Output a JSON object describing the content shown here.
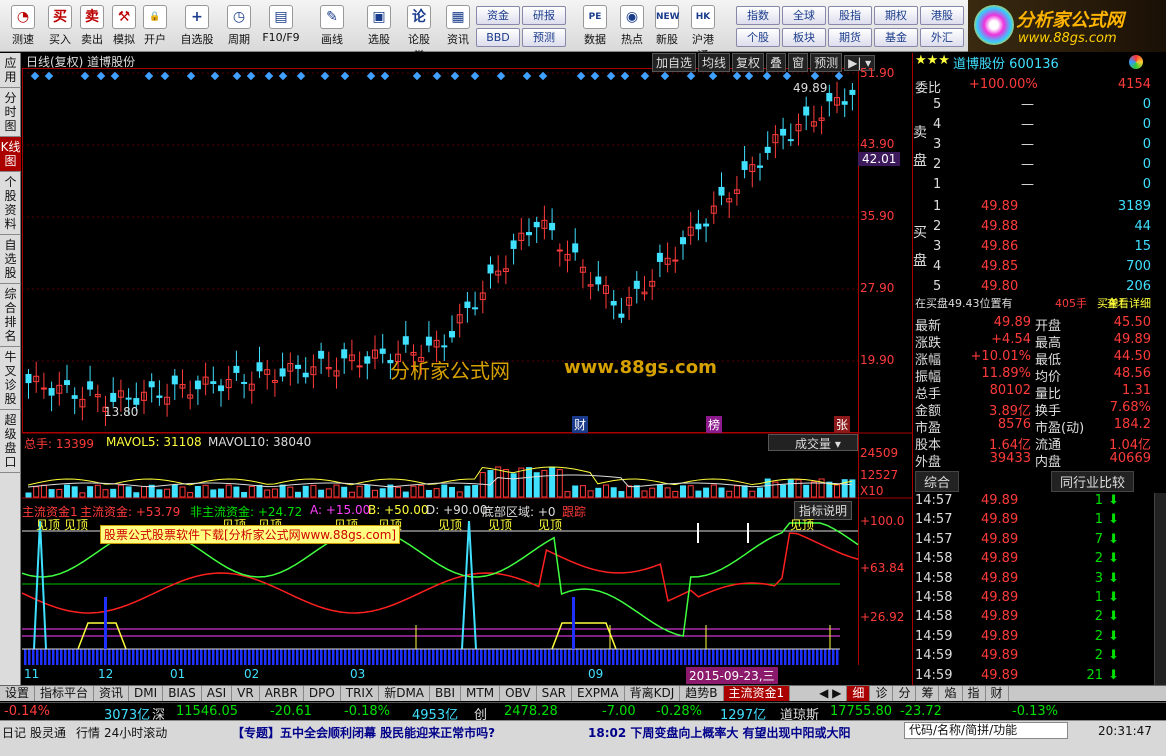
{
  "toolbar": {
    "buttons": [
      "测速",
      "买入",
      "卖出",
      "模拟",
      "开户",
      "自选股",
      "周期",
      "F10/F9",
      "画线",
      "选股",
      "论股堂",
      "资讯",
      "数据",
      "热点",
      "新股",
      "沪港通"
    ],
    "icons": [
      "speed-icon",
      "buy-icon",
      "sell-icon",
      "hammer-icon",
      "lock-icon",
      "plus-icon",
      "clock-icon",
      "f10-icon",
      "pen-icon",
      "screen-icon",
      "discuss-icon",
      "news-icon",
      "pe-icon",
      "hot-icon",
      "ipo-icon",
      "hk-icon"
    ],
    "icon_glyphs": [
      "◔",
      "买",
      "卖",
      "⚒",
      "🔒",
      "+",
      "◷",
      "▤",
      "✎",
      "▣",
      "论",
      "▦",
      "PE",
      "◉",
      "NEW",
      "HK"
    ],
    "small1": [
      "资金",
      "研报",
      "BBD",
      "预测"
    ],
    "small2": [
      "指数",
      "全球",
      "股指",
      "期权",
      "港股",
      "个股",
      "板块",
      "期货",
      "基金",
      "外汇"
    ]
  },
  "logo": {
    "name": "分析家公式网",
    "url": "www.88gs.com"
  },
  "lefttabs": [
    "应用",
    "分时图",
    "K线图",
    "个股资料",
    "自选股",
    "综合排名",
    "牛叉诊股",
    "超级盘口"
  ],
  "chart": {
    "title": "日线(复权)  道博股份",
    "buttons": [
      "加自选",
      "均线",
      "复权",
      "叠",
      "窗",
      "预测"
    ],
    "price_axis": [
      "51.90",
      "43.90",
      "35.90",
      "27.90",
      "19.90"
    ],
    "current_price_tag": "42.01",
    "high_label": "49.89",
    "low_label": "13.80",
    "watermark1": "分析家公式网",
    "watermark2": "www.88gs.com",
    "event_markers": [
      "财",
      "榜",
      "张"
    ],
    "vol_legend": {
      "a": "总手: 13399",
      "b": "MAVOL5: 31108",
      "c": "MAVOL10: 38040"
    },
    "vol_selector": "成交量",
    "vol_axis": [
      "24509",
      "12527",
      "X10"
    ],
    "ind_legend": {
      "a": "主流资金1",
      "b": "主流资金: +53.79",
      "c": "非主流资金: +24.72",
      "d": "A: +15.00",
      "e": "B: +50.00",
      "f": "D: +90.00",
      "g": "底部区域: +0",
      "h": "跟踪"
    },
    "ind_help": "指标说明",
    "ind_axis": [
      "+100.0",
      "+63.84",
      "+26.92"
    ],
    "ind_labels": [
      "见顶",
      "见顶",
      "见顶",
      "见顶",
      "见顶",
      "见顶",
      "见顶",
      "见顶",
      "见顶"
    ],
    "ad_banner": "股票公式股票软件下载[分析家公式网www.88gs.com]",
    "months": [
      "11",
      "12",
      "01",
      "02",
      "03",
      "09"
    ],
    "date_tag": "2015-09-23,三"
  },
  "quote": {
    "stars": "★★★",
    "name": "道博股份 600136",
    "weibi_label": "委比",
    "weibi": "+100.00%",
    "weicha": "4154",
    "sell_label": "卖盘",
    "buy_label": "买盘",
    "sell": [
      [
        "5",
        "—",
        "0"
      ],
      [
        "4",
        "—",
        "0"
      ],
      [
        "3",
        "—",
        "0"
      ],
      [
        "2",
        "—",
        "0"
      ],
      [
        "1",
        "—",
        "0"
      ]
    ],
    "buy": [
      [
        "1",
        "49.89",
        "3189"
      ],
      [
        "2",
        "49.88",
        "44"
      ],
      [
        "3",
        "49.86",
        "15"
      ],
      [
        "4",
        "49.85",
        "700"
      ],
      [
        "5",
        "49.80",
        "206"
      ]
    ],
    "info_line": {
      "a": "在买盘49.43位置有",
      "b": "405手",
      "c": "买单!",
      "d": "查看详细"
    },
    "stats": [
      [
        "最新",
        "49.89",
        "开盘",
        "45.50"
      ],
      [
        "涨跌",
        "+4.54",
        "最高",
        "49.89"
      ],
      [
        "涨幅",
        "+10.01%",
        "最低",
        "44.50"
      ],
      [
        "振幅",
        "11.89%",
        "均价",
        "48.56"
      ],
      [
        "总手",
        "80102",
        "量比",
        "1.31"
      ],
      [
        "金额",
        "3.89亿",
        "换手",
        "7.68%"
      ],
      [
        "市盈",
        "8576",
        "市盈(动)",
        "184.2"
      ],
      [
        "股本",
        "1.64亿",
        "流通",
        "1.04亿"
      ],
      [
        "外盘",
        "39433",
        "内盘",
        "40669"
      ]
    ],
    "tabs": [
      "综合",
      "同行业比较"
    ],
    "ticks": [
      [
        "14:57",
        "49.89",
        "1"
      ],
      [
        "14:57",
        "49.89",
        "1"
      ],
      [
        "14:57",
        "49.89",
        "7"
      ],
      [
        "14:58",
        "49.89",
        "2"
      ],
      [
        "14:58",
        "49.89",
        "3"
      ],
      [
        "14:58",
        "49.89",
        "1"
      ],
      [
        "14:58",
        "49.89",
        "2"
      ],
      [
        "14:59",
        "49.89",
        "2"
      ],
      [
        "14:59",
        "49.89",
        "2"
      ],
      [
        "14:59",
        "49.89",
        "21"
      ]
    ],
    "bottom_tabs": [
      "细",
      "诊",
      "分",
      "筹",
      "焰",
      "指",
      "财"
    ]
  },
  "tabstrip": [
    "设置",
    "指标平台",
    "资讯",
    "DMI",
    "BIAS",
    "ASI",
    "VR",
    "ARBR",
    "DPO",
    "TRIX",
    "新DMA",
    "BBI",
    "MTM",
    "OBV",
    "SAR",
    "EXPMA",
    "背离KDJ",
    "趋势B",
    "主流资金1"
  ],
  "status1": [
    [
      "-0.14%",
      "red"
    ],
    [
      "3073亿",
      "cyn"
    ],
    [
      "深",
      "wht"
    ],
    [
      "11546.05",
      "grn"
    ],
    [
      "-20.61",
      "grn"
    ],
    [
      "-0.18%",
      "grn"
    ],
    [
      "4953亿",
      "cyn"
    ],
    [
      "创",
      "wht"
    ],
    [
      "2478.28",
      "grn"
    ],
    [
      "-7.00",
      "grn"
    ],
    [
      "-0.28%",
      "grn"
    ],
    [
      "1297亿",
      "cyn"
    ],
    [
      "道琼斯",
      "wht"
    ],
    [
      "17755.80",
      "grn"
    ],
    [
      "-23.72",
      "grn"
    ],
    [
      "-0.13%",
      "grn"
    ]
  ],
  "status2": {
    "items": [
      "日记",
      "股灵通",
      "行情",
      "24小时滚动"
    ],
    "news1": "【专题】五中全会顺利闭幕 股民能迎来正常市吗?",
    "news2": "18:02 下周变盘向上概率大 有望出现中阳或大阳",
    "search": "代码/名称/简拼/功能",
    "time": "20:31:47"
  }
}
